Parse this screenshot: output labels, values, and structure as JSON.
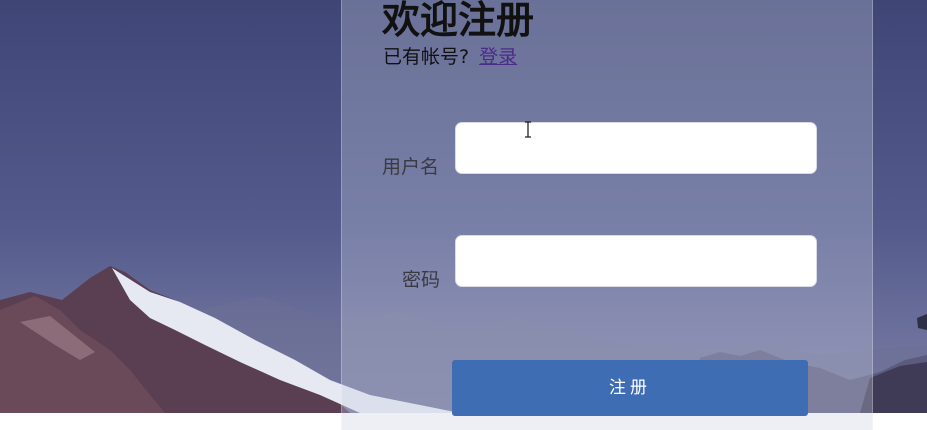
{
  "page": {
    "title": "欢迎注册"
  },
  "login_prompt": {
    "text": "已有帐号?",
    "link_label": "登录"
  },
  "form": {
    "username_label": "用户名",
    "username_value": "",
    "password_label": "密码",
    "password_value": "",
    "submit_label": "注册"
  },
  "colors": {
    "accent": "#3f6db3",
    "link": "#4b2a8a",
    "sky": "#4a4f80",
    "panel_tint": "#c8cde1"
  },
  "icons": {
    "cursor": "text-cursor-icon"
  }
}
